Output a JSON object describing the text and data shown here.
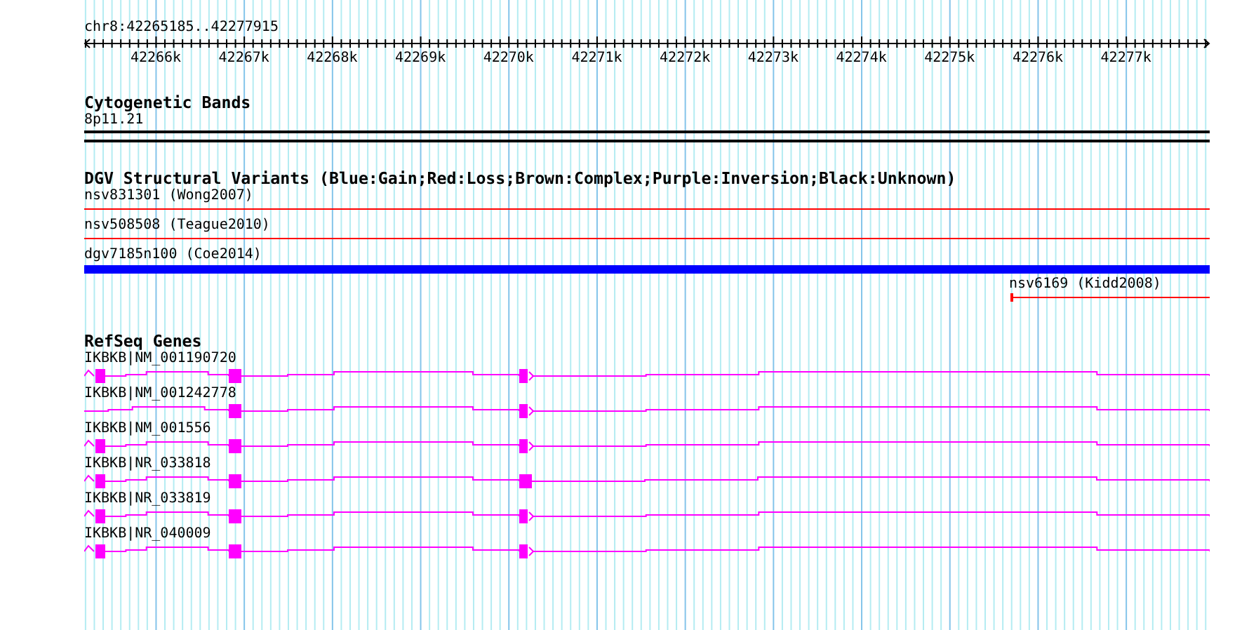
{
  "ruler": {
    "title": "chr8:42265185..42277915",
    "ticks": [
      "42266k",
      "42267k",
      "42268k",
      "42269k",
      "42270k",
      "42271k",
      "42272k",
      "42273k",
      "42274k",
      "42275k",
      "42276k",
      "42277k"
    ]
  },
  "cytogenetic_bands": {
    "title": "Cytogenetic Bands",
    "band": "8p11.21"
  },
  "dgv": {
    "title": "DGV Structural Variants (Blue:Gain;Red:Loss;Brown:Complex;Purple:Inversion;Black:Unknown)",
    "variants": [
      {
        "label": "nsv831301 (Wong2007)",
        "color": "#ff0000",
        "kind": "line"
      },
      {
        "label": "nsv508508 (Teague2010)",
        "color": "#ff0000",
        "kind": "line"
      },
      {
        "label": "dgv7185n100 (Coe2014)",
        "color": "#0000ff",
        "kind": "bar"
      },
      {
        "label": "nsv6169 (Kidd2008)",
        "color": "#ff0000",
        "kind": "partial"
      }
    ]
  },
  "refseq": {
    "title": "RefSeq Genes",
    "genes": [
      {
        "label": "IKBKB|NM_001190720",
        "kind": "standard"
      },
      {
        "label": "IKBKB|NM_001242778",
        "kind": "no_first_exon"
      },
      {
        "label": "IKBKB|NM_001556",
        "kind": "standard"
      },
      {
        "label": "IKBKB|NR_033818",
        "kind": "wide_end"
      },
      {
        "label": "IKBKB|NR_033819",
        "kind": "standard"
      },
      {
        "label": "IKBKB|NR_040009",
        "kind": "standard"
      }
    ]
  }
}
